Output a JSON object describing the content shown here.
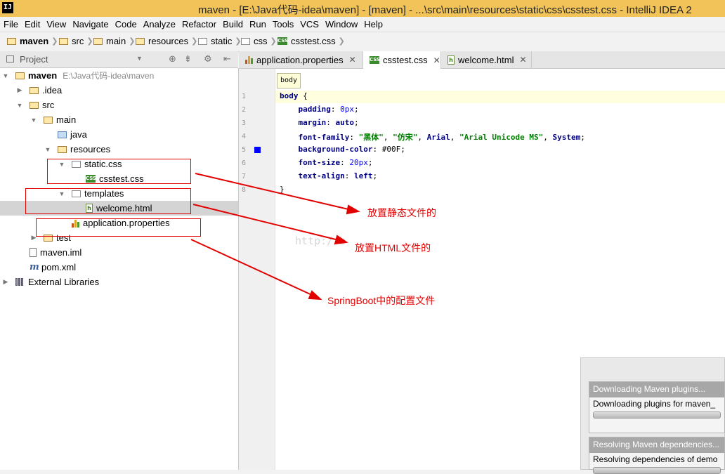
{
  "window": {
    "title": "maven - [E:\\Java代码-idea\\maven] - [maven] - ...\\src\\main\\resources\\static\\css\\csstest.css - IntelliJ IDEA 2",
    "logo": "IJ"
  },
  "menu": [
    "File",
    "Edit",
    "View",
    "Navigate",
    "Code",
    "Analyze",
    "Refactor",
    "Build",
    "Run",
    "Tools",
    "VCS",
    "Window",
    "Help"
  ],
  "breadcrumbs": [
    "maven",
    "src",
    "main",
    "resources",
    "static",
    "css",
    "csstest.css"
  ],
  "project_panel": {
    "label": "Project"
  },
  "tree": {
    "maven": "maven",
    "maven_path": "E:\\Java代码-idea\\maven",
    "idea": ".idea",
    "src": "src",
    "main": "main",
    "java": "java",
    "resources": "resources",
    "static_css": "static.css",
    "csstest": "csstest.css",
    "templates": "templates",
    "welcome": "welcome.html",
    "application": "application.properties",
    "test": "test",
    "maven_iml": "maven.iml",
    "pom": "pom.xml",
    "external": "External Libraries"
  },
  "tabs": [
    {
      "label": "application.properties",
      "icon": "properties-file-icon"
    },
    {
      "label": "csstest.css",
      "icon": "css-file-icon",
      "active": true
    },
    {
      "label": "welcome.html",
      "icon": "html-file-icon"
    }
  ],
  "editor": {
    "tooltip": "body",
    "line_numbers": [
      "1",
      "2",
      "3",
      "4",
      "5",
      "6",
      "7",
      "8"
    ],
    "lines": {
      "l1a": "body",
      "l1b": " {",
      "l2p": "padding",
      "l2n": "0px",
      "l3p": "margin",
      "l3v": "auto",
      "l4p": "font-family",
      "l4s1": "\"黑体\"",
      "l4s2": "\"仿宋\"",
      "l4v1": "Arial",
      "l4s3": "\"Arial Unicode MS\"",
      "l4v2": "System",
      "l5p": "background-color",
      "l5v": "#00F",
      "l6p": "font-size",
      "l6n": "20px",
      "l7p": "text-align",
      "l7v": "left",
      "l8": "}"
    },
    "color_swatch": "#0000FF",
    "watermark": "http://b"
  },
  "annotations": {
    "static_note": "放置静态文件的",
    "html_note": "放置HTML文件的",
    "config_note": "SpringBoot中的配置文件",
    "color": "#e30000"
  },
  "popups": [
    {
      "header": "Downloading Maven plugins...",
      "body": "Downloading plugins for maven_"
    },
    {
      "header": "Resolving Maven dependencies...",
      "body": "Resolving dependencies of demo"
    }
  ]
}
